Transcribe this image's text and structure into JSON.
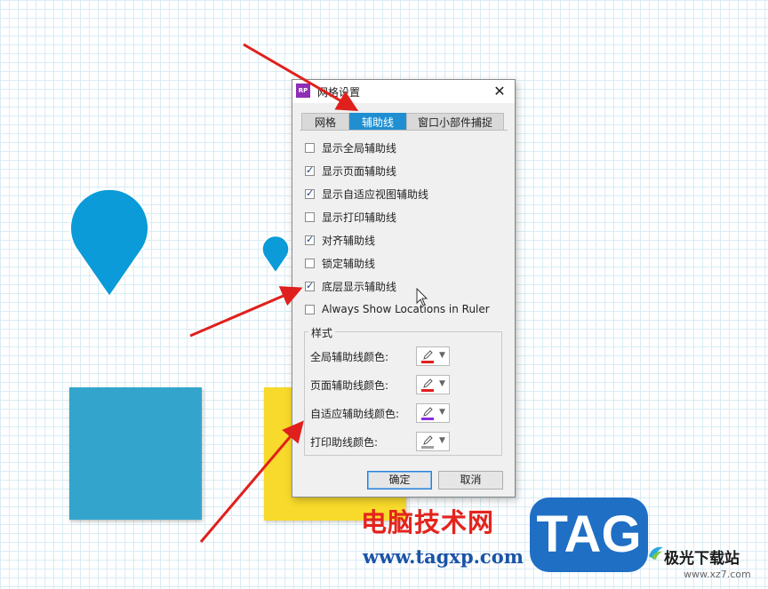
{
  "dialog": {
    "app_icon_text": "RP",
    "title": "网格设置",
    "close_glyph": "✕",
    "tabs": [
      {
        "label": "网格",
        "active": false
      },
      {
        "label": "辅助线",
        "active": true
      },
      {
        "label": "窗口小部件捕捉",
        "active": false
      }
    ],
    "checkboxes": [
      {
        "label": "显示全局辅助线",
        "checked": false
      },
      {
        "label": "显示页面辅助线",
        "checked": true
      },
      {
        "label": "显示自适应视图辅助线",
        "checked": true
      },
      {
        "label": "显示打印辅助线",
        "checked": false
      },
      {
        "label": "对齐辅助线",
        "checked": true
      },
      {
        "label": "锁定辅助线",
        "checked": false
      },
      {
        "label": "底层显示辅助线",
        "checked": true
      },
      {
        "label": "Always Show Locations in Ruler",
        "checked": false
      }
    ],
    "style_group": {
      "legend": "样式",
      "rows": [
        {
          "label": "全局辅助线颜色:",
          "color": "#e0201c"
        },
        {
          "label": "页面辅助线颜色:",
          "color": "#e0201c"
        },
        {
          "label": "自适应辅助线颜色:",
          "color": "#8a2be2"
        },
        {
          "label": "打印助线颜色:",
          "color": "#a0a0a0"
        }
      ]
    },
    "buttons": {
      "ok": "确定",
      "cancel": "取消"
    }
  },
  "canvas": {
    "shape_colors": {
      "pin": "#0a9bd8",
      "square_blue": "#33a5cc",
      "square_yellow": "#f7da2b"
    },
    "arrow_color": "#e0201c"
  },
  "watermark": {
    "cn_text": "电脑技术网",
    "url_text": "www.tagxp.com",
    "badge_text": "TAG",
    "site_cn": "极光下载站",
    "site_url": "www.xz7.com"
  }
}
